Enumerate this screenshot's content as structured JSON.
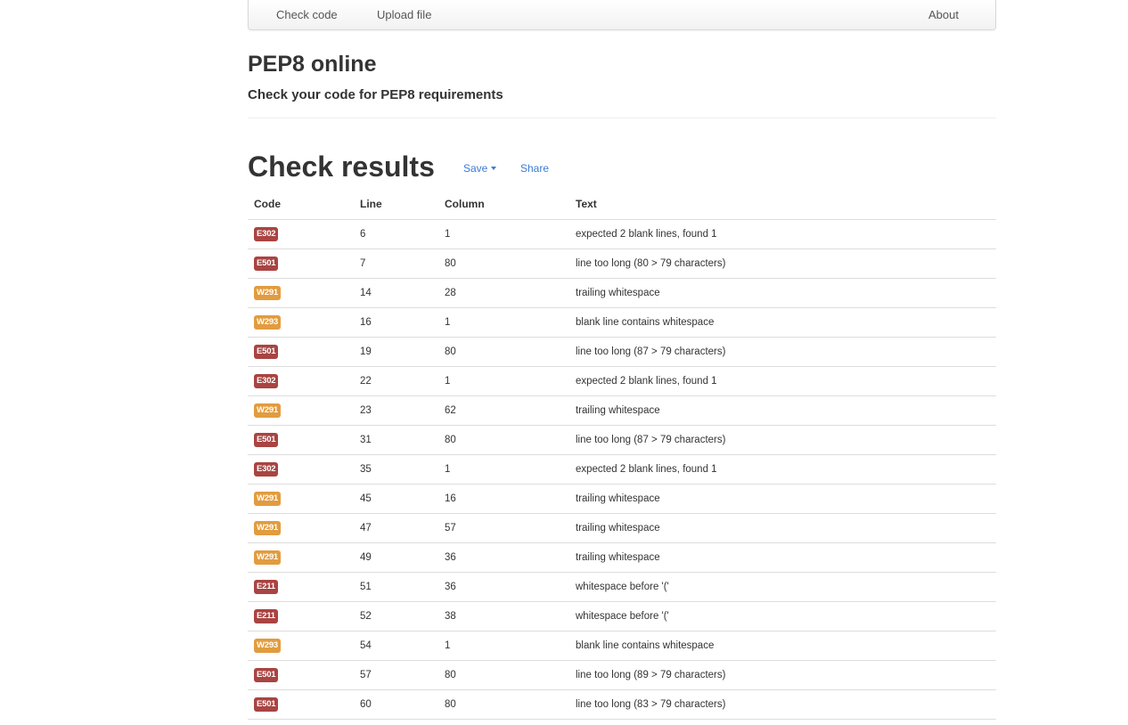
{
  "nav": {
    "check_code": "Check code",
    "upload_file": "Upload file",
    "about": "About"
  },
  "header": {
    "title": "PEP8 online",
    "subtitle": "Check your code for PEP8 requirements"
  },
  "results": {
    "title": "Check results",
    "save_label": "Save",
    "share_label": "Share",
    "columns": [
      "Code",
      "Line",
      "Column",
      "Text"
    ],
    "rows": [
      {
        "code": "E302",
        "type": "error",
        "line": "6",
        "column": "1",
        "text": "expected 2 blank lines, found 1"
      },
      {
        "code": "E501",
        "type": "error",
        "line": "7",
        "column": "80",
        "text": "line too long (80 > 79 characters)"
      },
      {
        "code": "W291",
        "type": "warning",
        "line": "14",
        "column": "28",
        "text": "trailing whitespace"
      },
      {
        "code": "W293",
        "type": "warning",
        "line": "16",
        "column": "1",
        "text": "blank line contains whitespace"
      },
      {
        "code": "E501",
        "type": "error",
        "line": "19",
        "column": "80",
        "text": "line too long (87 > 79 characters)"
      },
      {
        "code": "E302",
        "type": "error",
        "line": "22",
        "column": "1",
        "text": "expected 2 blank lines, found 1"
      },
      {
        "code": "W291",
        "type": "warning",
        "line": "23",
        "column": "62",
        "text": "trailing whitespace"
      },
      {
        "code": "E501",
        "type": "error",
        "line": "31",
        "column": "80",
        "text": "line too long (87 > 79 characters)"
      },
      {
        "code": "E302",
        "type": "error",
        "line": "35",
        "column": "1",
        "text": "expected 2 blank lines, found 1"
      },
      {
        "code": "W291",
        "type": "warning",
        "line": "45",
        "column": "16",
        "text": "trailing whitespace"
      },
      {
        "code": "W291",
        "type": "warning",
        "line": "47",
        "column": "57",
        "text": "trailing whitespace"
      },
      {
        "code": "W291",
        "type": "warning",
        "line": "49",
        "column": "36",
        "text": "trailing whitespace"
      },
      {
        "code": "E211",
        "type": "error",
        "line": "51",
        "column": "36",
        "text": "whitespace before '('"
      },
      {
        "code": "E211",
        "type": "error",
        "line": "52",
        "column": "38",
        "text": "whitespace before '('"
      },
      {
        "code": "W293",
        "type": "warning",
        "line": "54",
        "column": "1",
        "text": "blank line contains whitespace"
      },
      {
        "code": "E501",
        "type": "error",
        "line": "57",
        "column": "80",
        "text": "line too long (89 > 79 characters)"
      },
      {
        "code": "E501",
        "type": "error",
        "line": "60",
        "column": "80",
        "text": "line too long (83 > 79 characters)"
      }
    ]
  },
  "colors": {
    "error_badge": "#a94442",
    "warning_badge": "#e29c3f",
    "link": "#3a7bd5"
  }
}
